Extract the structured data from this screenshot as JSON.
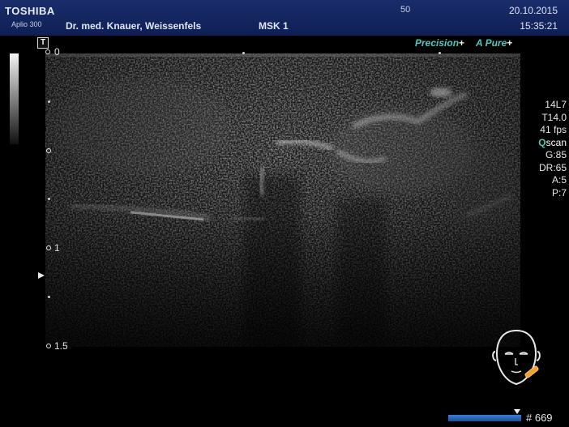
{
  "header": {
    "brand": "TOSHIBA",
    "model": "Aplio 300",
    "clinic": "Dr. med. Knauer, Weissenfels",
    "preset": "MSK 1",
    "frame_rate_label": "50",
    "date": "20.10.2015",
    "time": "15:35:21"
  },
  "image_labels": {
    "transducer_marker": "T",
    "precision": "Precision",
    "apure": "A",
    "apure_suffix": "Pure",
    "plus": "+"
  },
  "depth_scale": {
    "labels": [
      "0",
      "1",
      "1.5"
    ],
    "unit_note": ""
  },
  "parameters": {
    "probe": "14L7",
    "frequency": "T14.0",
    "fps": "41 fps",
    "qscan_q": "Q",
    "qscan_rest": "scan",
    "gain": "G:85",
    "dynamic_range": "DR:65",
    "a": "A:5",
    "p": "P:7"
  },
  "cine": {
    "frame_count": "# 669"
  },
  "colors": {
    "header_bg": "#15276a",
    "accent_teal": "#4ec9c0",
    "cine_blue": "#2e6bc4",
    "probe_marker_orange": "#f0a030"
  },
  "icons": {
    "body_marker": "head-face-icon",
    "probe_marker": "probe-icon"
  }
}
